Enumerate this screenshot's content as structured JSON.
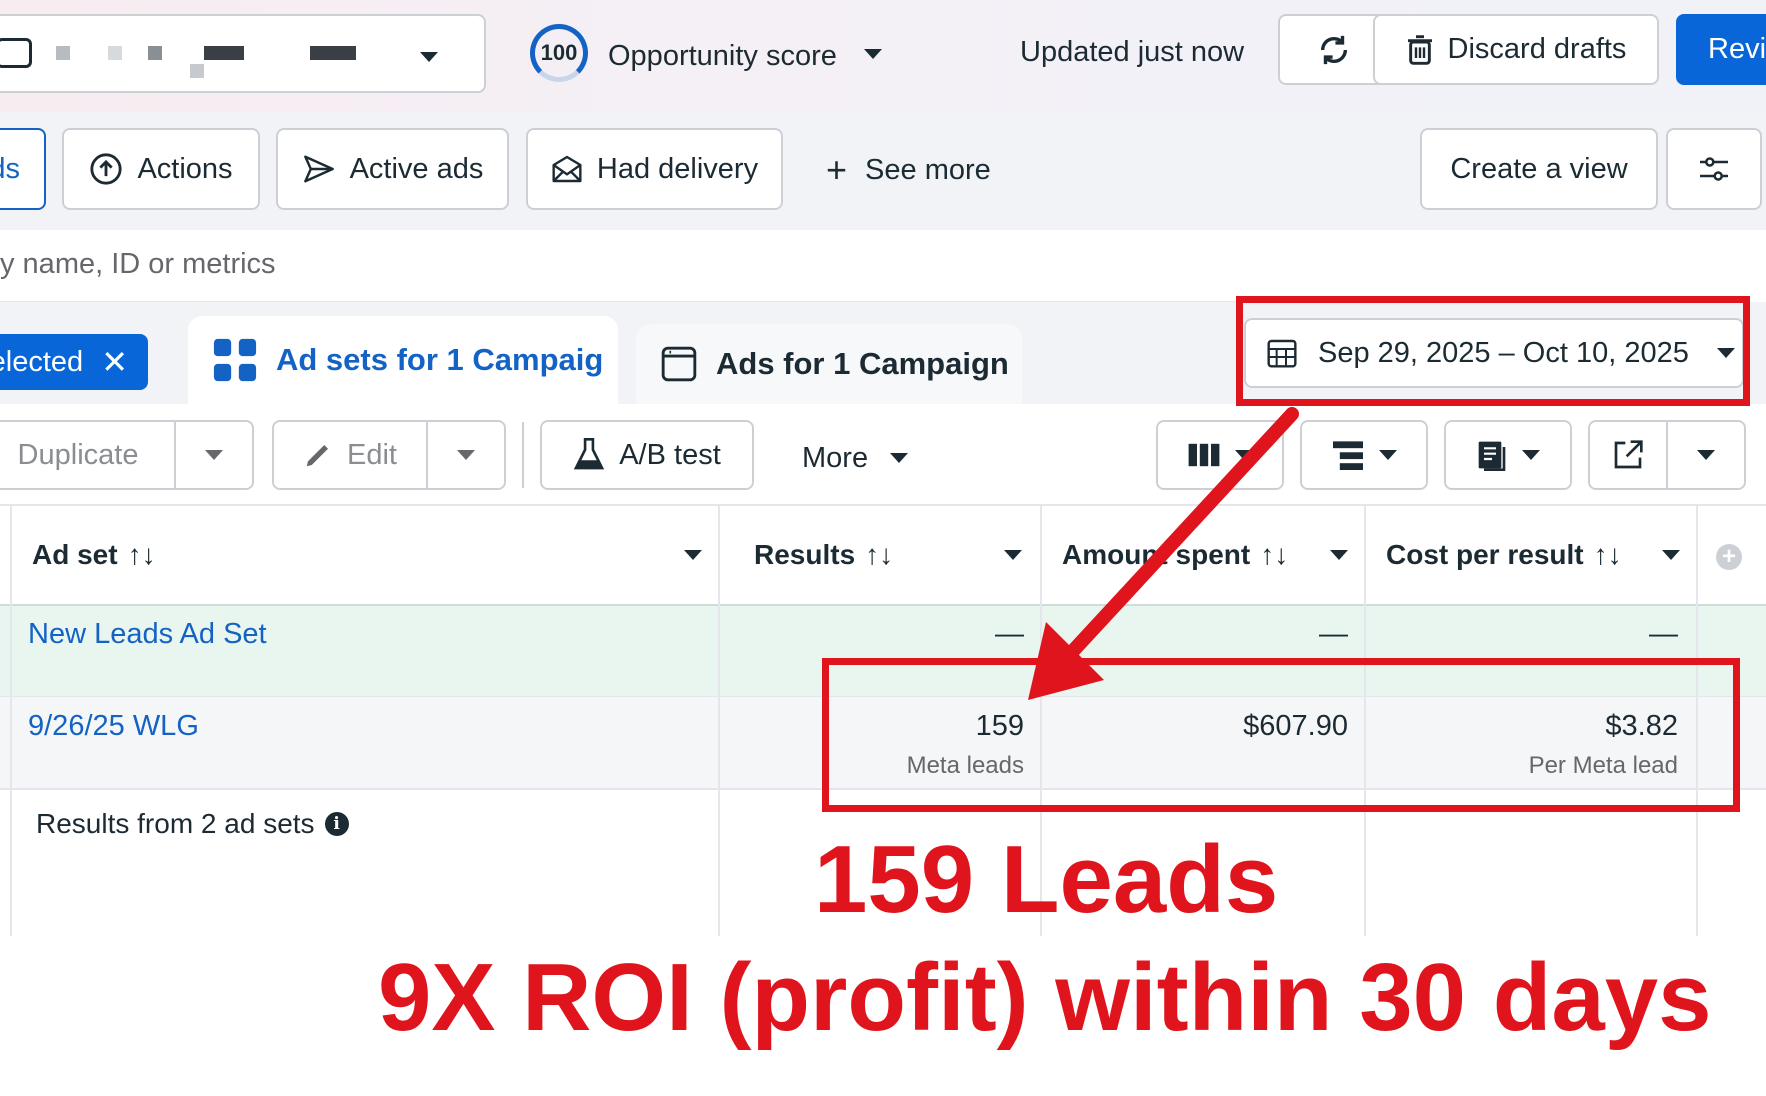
{
  "header": {
    "opportunity_score_value": "100",
    "opportunity_score_label": "Opportunity score",
    "updated_text": "Updated just now",
    "discard_drafts_label": "Discard drafts",
    "review_label": "Revi"
  },
  "filters": {
    "partial_tab_label": "ds",
    "actions_label": "Actions",
    "active_ads_label": "Active ads",
    "had_delivery_label": "Had delivery",
    "see_more_label": "See more",
    "create_view_label": "Create a view"
  },
  "search": {
    "placeholder": "y name, ID or metrics"
  },
  "tabs": {
    "selected_chip_label": "elected",
    "ad_sets_tab_label": "Ad sets for 1 Campaig",
    "ads_tab_label": "Ads for 1 Campaign"
  },
  "date_range": {
    "label": "Sep 29, 2025 – Oct 10, 2025"
  },
  "toolbar": {
    "duplicate_label": "Duplicate",
    "edit_label": "Edit",
    "ab_test_label": "A/B test",
    "more_label": "More"
  },
  "table": {
    "headers": {
      "ad_set": "Ad set",
      "results": "Results",
      "amount_spent": "Amount spent",
      "cost_per_result": "Cost per result",
      "sort_glyph": "↑↓"
    },
    "rows": [
      {
        "name": "New Leads Ad Set",
        "results": "—",
        "amount_spent": "—",
        "cost_per_result": "—"
      },
      {
        "name": "9/26/25 WLG",
        "results": "159",
        "results_sub": "Meta leads",
        "amount_spent": "$607.90",
        "cost_per_result": "$3.82",
        "cost_sub": "Per Meta lead"
      }
    ],
    "summary_label": "Results from 2 ad sets"
  },
  "annotations": {
    "headline": "159 Leads",
    "subline": "9X ROI (profit) within 30 days",
    "color": "#e0141c"
  },
  "colors": {
    "primary_blue": "#1463c4",
    "accent_green_row": "#e8f6ef"
  }
}
